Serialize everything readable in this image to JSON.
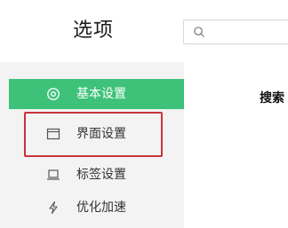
{
  "header": {
    "title": "选项",
    "search_placeholder": "",
    "search_value": ""
  },
  "sidebar": {
    "items": [
      {
        "label": "基本设置",
        "icon": "target-icon",
        "active": true
      },
      {
        "label": "界面设置",
        "icon": "window-icon",
        "active": false,
        "highlighted": true
      },
      {
        "label": "标签设置",
        "icon": "laptop-icon",
        "active": false
      },
      {
        "label": "优化加速",
        "icon": "lightning-icon",
        "active": false
      }
    ]
  },
  "main": {
    "section_title_partial": "搜索"
  },
  "colors": {
    "active_bg": "#3ec27a",
    "highlight_border": "#c9333a",
    "sidebar_bg": "#f3f3f3"
  }
}
